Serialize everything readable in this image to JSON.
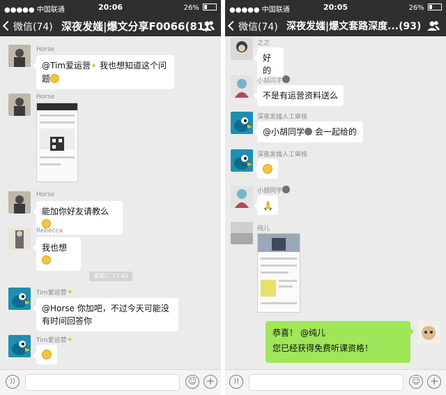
{
  "left": {
    "status": {
      "carrier": "●●●●● 中国联通",
      "time": "20:06",
      "battery": "26%"
    },
    "nav": {
      "back_label": "微信(74)",
      "title": "深夜发媸|爆文分享F0066(81)"
    },
    "messages": [
      {
        "nick": "Horse",
        "text_pre": "@Tim爱运营",
        "text_post": " 我也想知道这个问题"
      },
      {
        "nick": "Horse"
      },
      {
        "nick": "Horse",
        "text": "能加你好友请教么"
      },
      {
        "nick": "Rebecca",
        "text": "我也想"
      },
      {
        "nick": "Tim爱运营",
        "text": "@Horse 你加吧，不过今天可能没有时间回答你"
      },
      {
        "nick": "Tim爱运营"
      }
    ],
    "timestamp": "星期二 17:40"
  },
  "right": {
    "status": {
      "carrier": "●●●●● 中国联通",
      "time": "20:05",
      "battery": "26%"
    },
    "nav": {
      "back_label": "微信(74)",
      "title": "深夜发媸|爆文套路深度...(93)"
    },
    "messages": [
      {
        "nick": "之之",
        "text": "好的"
      },
      {
        "nick": "小胡同学",
        "text": "不是有运营资料送么"
      },
      {
        "nick": "深夜发媸人工审核",
        "text_pre": "@小胡同学",
        "text_post": " 会一起给的"
      },
      {
        "nick": "深夜发媸人工审核"
      },
      {
        "nick": "小胡同学",
        "text": "🙏"
      },
      {
        "nick": "纯儿"
      },
      {
        "nick": "",
        "line1": "恭喜！ @纯儿",
        "line2": "您已经获得免费听课资格！"
      }
    ]
  }
}
